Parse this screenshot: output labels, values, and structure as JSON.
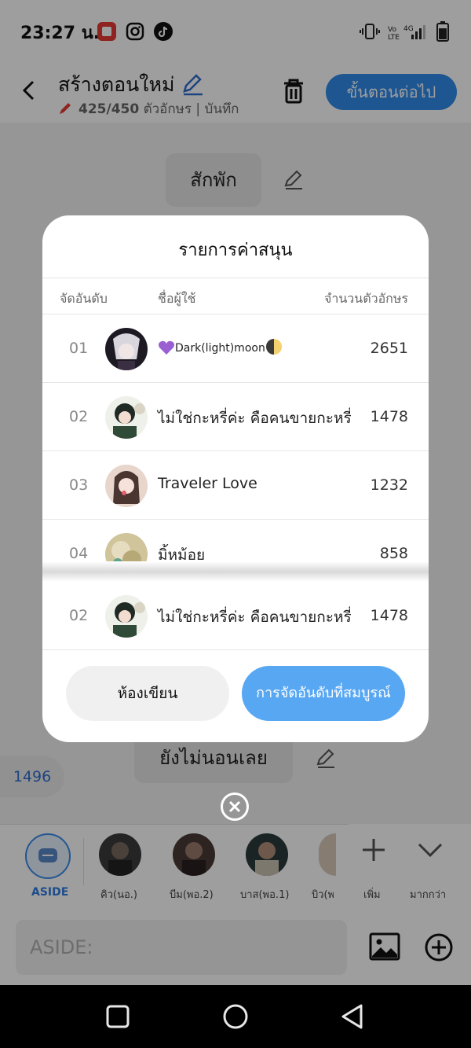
{
  "status_bar": {
    "time": "23:27 น."
  },
  "header": {
    "title": "สร้างตอนใหม่",
    "char_count": "425/450",
    "subtitle_rest": "ตัวอักษร | บันทึก",
    "next_button": "ขั้นตอนต่อไป"
  },
  "chat": {
    "bubble_top": "สักพัก",
    "bubble_bottom": "ยังไม่นอนเลย",
    "count_chip": "1496"
  },
  "modal": {
    "title": "รายการค่าสนุน",
    "col_rank": "จัดอันดับ",
    "col_user": "ชื่อผู้ใช้",
    "col_chars": "จำนวนตัวอักษร",
    "rows": [
      {
        "rank": "01",
        "name": "Dark(light)moon",
        "chars": "2651"
      },
      {
        "rank": "02",
        "name": "ไม่ใช่กะหรี่ค่ะ คือคนขายกะหรี่",
        "chars": "1478"
      },
      {
        "rank": "03",
        "name": "Traveler Love",
        "chars": "1232"
      },
      {
        "rank": "04",
        "name": "มิ้หม้อย",
        "chars": "858"
      }
    ],
    "my_row": {
      "rank": "02",
      "name": "ไม่ใช่กะหรี่ค่ะ คือคนขายกะหรี่",
      "chars": "1478"
    },
    "btn_left": "ห้องเขียน",
    "btn_right": "การจัดอันดับที่สมบูรณ์"
  },
  "characters": {
    "aside_label": "ASIDE",
    "items": [
      {
        "label": "คิว(นอ.)"
      },
      {
        "label": "บีม(พอ.2)"
      },
      {
        "label": "บาส(พอ.1)"
      },
      {
        "label": "บิว(พ"
      }
    ],
    "add_label": "เพิ่ม",
    "more_label": "มากกว่า"
  },
  "input": {
    "placeholder": "ASIDE:"
  }
}
